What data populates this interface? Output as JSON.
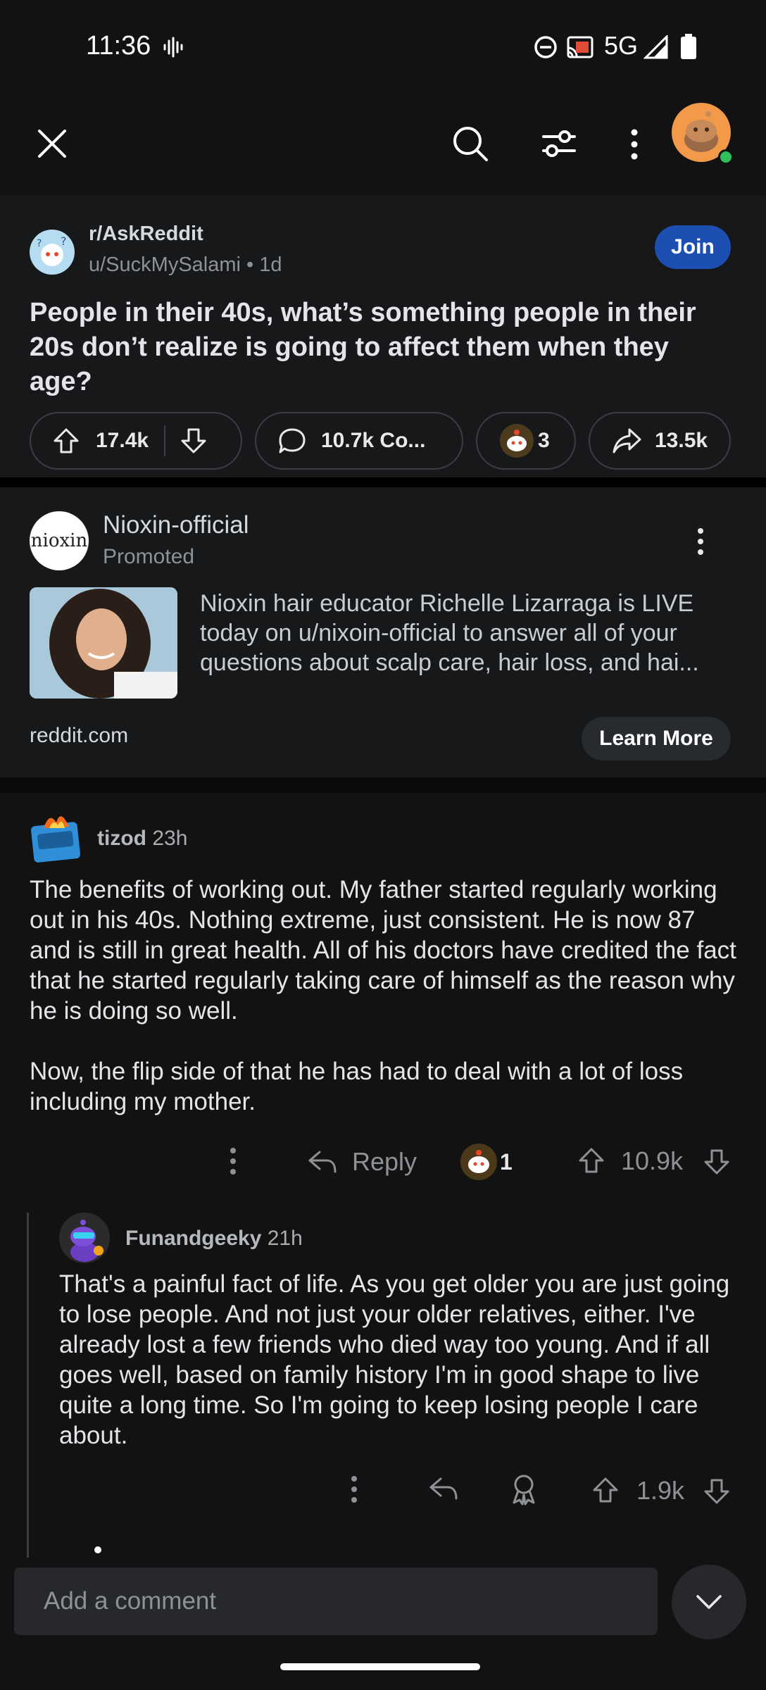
{
  "status_bar": {
    "time": "11:36",
    "network": "5G"
  },
  "nav": {
    "icons": [
      "close-icon",
      "search-icon",
      "filter-icon",
      "more-icon",
      "avatar"
    ]
  },
  "post": {
    "subreddit": "r/AskReddit",
    "meta": "u/SuckMySalami • 1d",
    "join_label": "Join",
    "title": "People in their 40s, what’s something people in their 20s don’t realize is going to affect them when they age?",
    "upvotes": "17.4k",
    "comments": "10.7k Co...",
    "awards": "3",
    "shares": "13.5k"
  },
  "ad": {
    "logo_text": "nioxin",
    "advertiser": "Nioxin-official",
    "promoted": "Promoted",
    "text": "Nioxin hair educator Richelle Lizarraga is LIVE today on u/nixoin-official to answer all of your questions about scalp care, hair loss, and hai...",
    "domain": "reddit.com",
    "cta": "Learn More"
  },
  "comments": [
    {
      "user": "tizod",
      "age": "23h",
      "paragraphs": [
        "The benefits of working out.  My father started regularly working out in his 40s.  Nothing extreme, just consistent.  He is now 87 and is still in great health.  All of his doctors have credited the fact that he started regularly taking care of himself as the reason why he is doing so well.",
        "Now, the flip side of that he has had to deal with a lot of loss including my mother."
      ],
      "reply_label": "Reply",
      "awards": "1",
      "score": "10.9k"
    },
    {
      "user": "Funandgeeky",
      "age": "21h",
      "paragraphs": [
        "That's a painful fact of life. As you get older you are just going to lose people. And not just your older relatives, either. I've already lost a few friends who died way too young. And if all goes well, based on family history I'm in good shape to live quite a long time. So I'm going to keep losing people I care about."
      ],
      "score": "1.9k"
    }
  ],
  "composer": {
    "placeholder": "Add a comment"
  },
  "colors": {
    "join": "#1d4fb3",
    "background": "#121213",
    "card": "#17181a"
  }
}
